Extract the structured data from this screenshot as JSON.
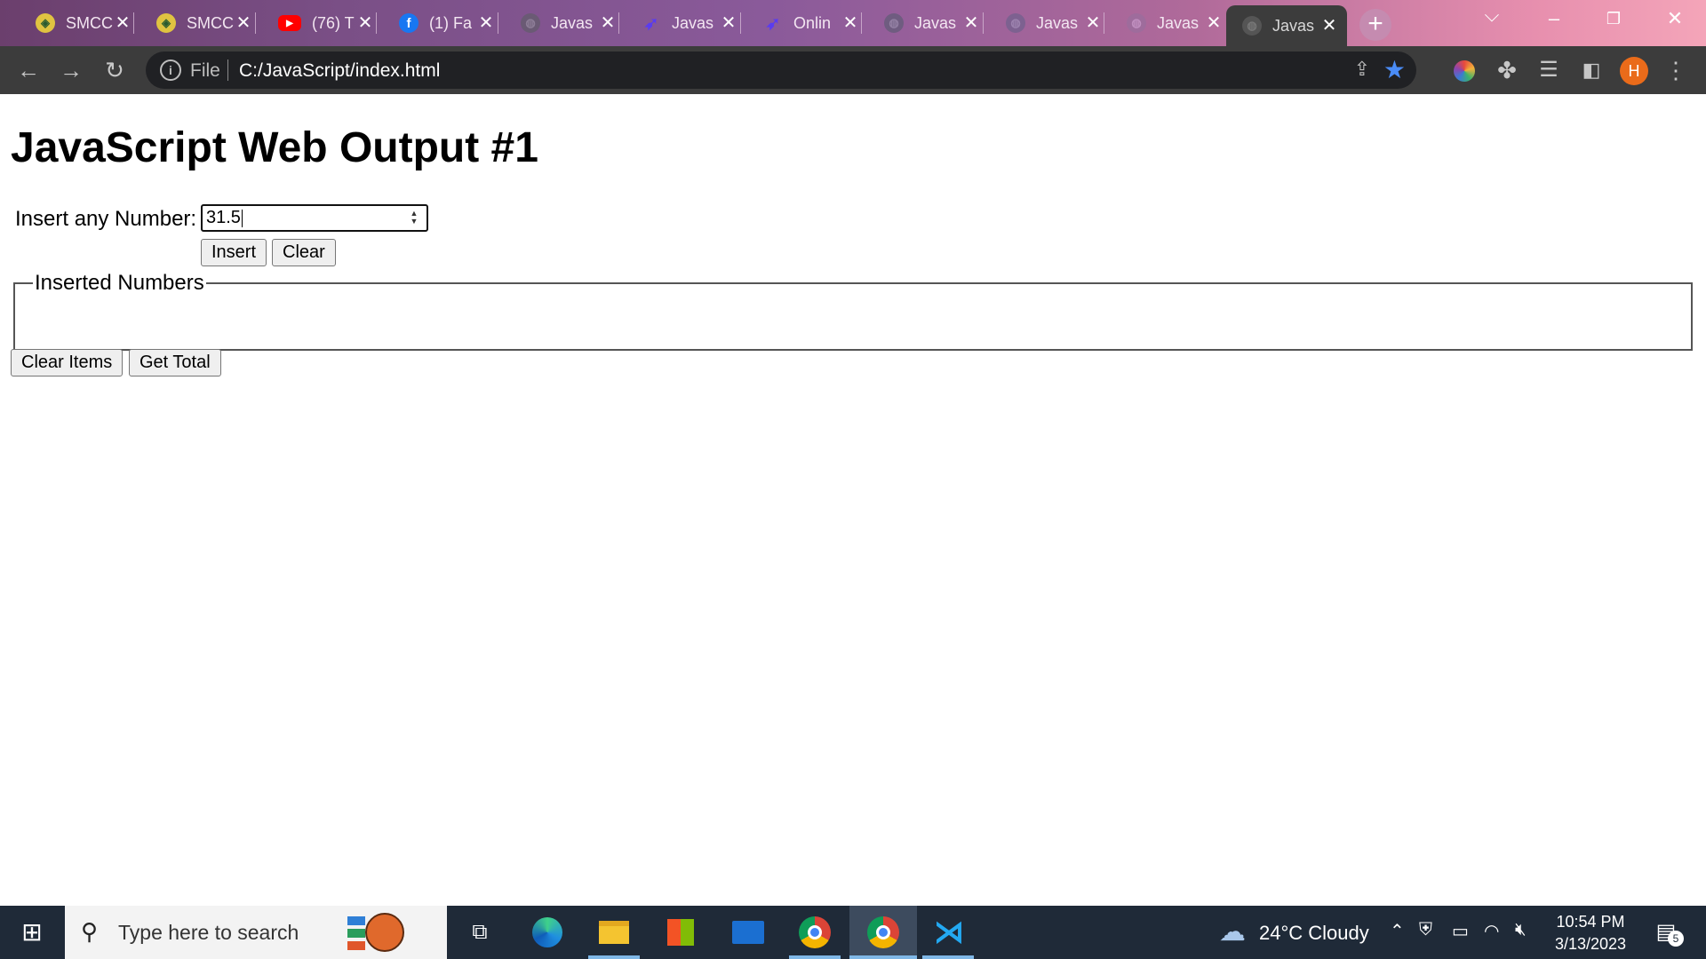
{
  "browser": {
    "tabs": [
      {
        "title": "SMCC",
        "favicon": "shield-icon"
      },
      {
        "title": "SMCC",
        "favicon": "shield-icon"
      },
      {
        "title": "(76) T",
        "favicon": "youtube-icon"
      },
      {
        "title": "(1) Fa",
        "favicon": "facebook-icon"
      },
      {
        "title": "Javas",
        "favicon": "globe-icon"
      },
      {
        "title": "Javas",
        "favicon": "feather-icon"
      },
      {
        "title": "Onlin",
        "favicon": "feather-icon"
      },
      {
        "title": "Javas",
        "favicon": "globe-icon"
      },
      {
        "title": "Javas",
        "favicon": "globe-icon"
      },
      {
        "title": "Javas",
        "favicon": "globe-icon"
      },
      {
        "title": "Javas",
        "favicon": "globe-icon",
        "active": true
      }
    ],
    "address": {
      "scheme": "File",
      "url": "C:/JavaScript/index.html"
    },
    "profile_initial": "H"
  },
  "page": {
    "heading": "JavaScript Web Output #1",
    "number_label": "Insert any Number:",
    "number_value": "31.5",
    "insert_label": "Insert",
    "clear_label": "Clear",
    "inserted_legend": "Inserted Numbers",
    "clear_items_label": "Clear Items",
    "get_total_label": "Get Total"
  },
  "taskbar": {
    "search_placeholder": "Type here to search",
    "weather": "24°C  Cloudy",
    "time": "10:54 PM",
    "date": "3/13/2023",
    "notification_count": "5"
  }
}
